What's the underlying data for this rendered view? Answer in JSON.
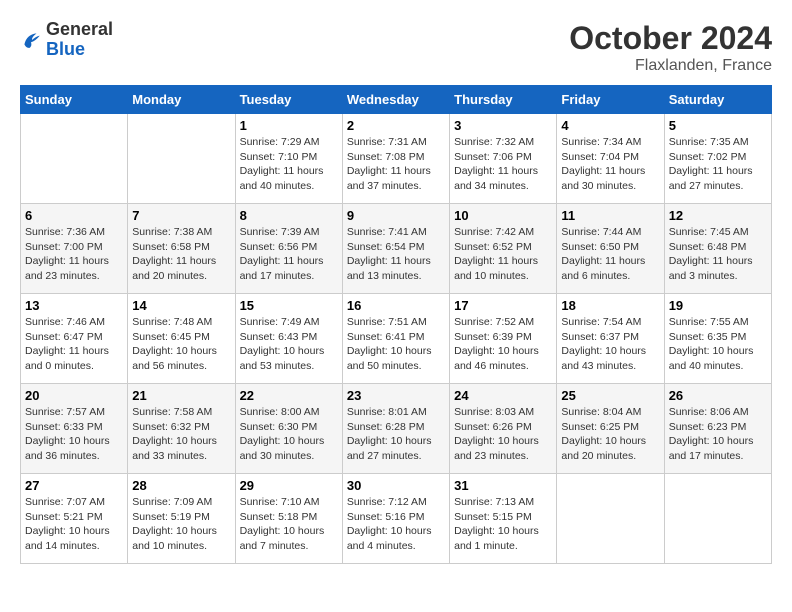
{
  "logo": {
    "general": "General",
    "blue": "Blue"
  },
  "title": "October 2024",
  "location": "Flaxlanden, France",
  "days_of_week": [
    "Sunday",
    "Monday",
    "Tuesday",
    "Wednesday",
    "Thursday",
    "Friday",
    "Saturday"
  ],
  "weeks": [
    [
      {
        "day": "",
        "info": ""
      },
      {
        "day": "",
        "info": ""
      },
      {
        "day": "1",
        "info": "Sunrise: 7:29 AM\nSunset: 7:10 PM\nDaylight: 11 hours and 40 minutes."
      },
      {
        "day": "2",
        "info": "Sunrise: 7:31 AM\nSunset: 7:08 PM\nDaylight: 11 hours and 37 minutes."
      },
      {
        "day": "3",
        "info": "Sunrise: 7:32 AM\nSunset: 7:06 PM\nDaylight: 11 hours and 34 minutes."
      },
      {
        "day": "4",
        "info": "Sunrise: 7:34 AM\nSunset: 7:04 PM\nDaylight: 11 hours and 30 minutes."
      },
      {
        "day": "5",
        "info": "Sunrise: 7:35 AM\nSunset: 7:02 PM\nDaylight: 11 hours and 27 minutes."
      }
    ],
    [
      {
        "day": "6",
        "info": "Sunrise: 7:36 AM\nSunset: 7:00 PM\nDaylight: 11 hours and 23 minutes."
      },
      {
        "day": "7",
        "info": "Sunrise: 7:38 AM\nSunset: 6:58 PM\nDaylight: 11 hours and 20 minutes."
      },
      {
        "day": "8",
        "info": "Sunrise: 7:39 AM\nSunset: 6:56 PM\nDaylight: 11 hours and 17 minutes."
      },
      {
        "day": "9",
        "info": "Sunrise: 7:41 AM\nSunset: 6:54 PM\nDaylight: 11 hours and 13 minutes."
      },
      {
        "day": "10",
        "info": "Sunrise: 7:42 AM\nSunset: 6:52 PM\nDaylight: 11 hours and 10 minutes."
      },
      {
        "day": "11",
        "info": "Sunrise: 7:44 AM\nSunset: 6:50 PM\nDaylight: 11 hours and 6 minutes."
      },
      {
        "day": "12",
        "info": "Sunrise: 7:45 AM\nSunset: 6:48 PM\nDaylight: 11 hours and 3 minutes."
      }
    ],
    [
      {
        "day": "13",
        "info": "Sunrise: 7:46 AM\nSunset: 6:47 PM\nDaylight: 11 hours and 0 minutes."
      },
      {
        "day": "14",
        "info": "Sunrise: 7:48 AM\nSunset: 6:45 PM\nDaylight: 10 hours and 56 minutes."
      },
      {
        "day": "15",
        "info": "Sunrise: 7:49 AM\nSunset: 6:43 PM\nDaylight: 10 hours and 53 minutes."
      },
      {
        "day": "16",
        "info": "Sunrise: 7:51 AM\nSunset: 6:41 PM\nDaylight: 10 hours and 50 minutes."
      },
      {
        "day": "17",
        "info": "Sunrise: 7:52 AM\nSunset: 6:39 PM\nDaylight: 10 hours and 46 minutes."
      },
      {
        "day": "18",
        "info": "Sunrise: 7:54 AM\nSunset: 6:37 PM\nDaylight: 10 hours and 43 minutes."
      },
      {
        "day": "19",
        "info": "Sunrise: 7:55 AM\nSunset: 6:35 PM\nDaylight: 10 hours and 40 minutes."
      }
    ],
    [
      {
        "day": "20",
        "info": "Sunrise: 7:57 AM\nSunset: 6:33 PM\nDaylight: 10 hours and 36 minutes."
      },
      {
        "day": "21",
        "info": "Sunrise: 7:58 AM\nSunset: 6:32 PM\nDaylight: 10 hours and 33 minutes."
      },
      {
        "day": "22",
        "info": "Sunrise: 8:00 AM\nSunset: 6:30 PM\nDaylight: 10 hours and 30 minutes."
      },
      {
        "day": "23",
        "info": "Sunrise: 8:01 AM\nSunset: 6:28 PM\nDaylight: 10 hours and 27 minutes."
      },
      {
        "day": "24",
        "info": "Sunrise: 8:03 AM\nSunset: 6:26 PM\nDaylight: 10 hours and 23 minutes."
      },
      {
        "day": "25",
        "info": "Sunrise: 8:04 AM\nSunset: 6:25 PM\nDaylight: 10 hours and 20 minutes."
      },
      {
        "day": "26",
        "info": "Sunrise: 8:06 AM\nSunset: 6:23 PM\nDaylight: 10 hours and 17 minutes."
      }
    ],
    [
      {
        "day": "27",
        "info": "Sunrise: 7:07 AM\nSunset: 5:21 PM\nDaylight: 10 hours and 14 minutes."
      },
      {
        "day": "28",
        "info": "Sunrise: 7:09 AM\nSunset: 5:19 PM\nDaylight: 10 hours and 10 minutes."
      },
      {
        "day": "29",
        "info": "Sunrise: 7:10 AM\nSunset: 5:18 PM\nDaylight: 10 hours and 7 minutes."
      },
      {
        "day": "30",
        "info": "Sunrise: 7:12 AM\nSunset: 5:16 PM\nDaylight: 10 hours and 4 minutes."
      },
      {
        "day": "31",
        "info": "Sunrise: 7:13 AM\nSunset: 5:15 PM\nDaylight: 10 hours and 1 minute."
      },
      {
        "day": "",
        "info": ""
      },
      {
        "day": "",
        "info": ""
      }
    ]
  ]
}
